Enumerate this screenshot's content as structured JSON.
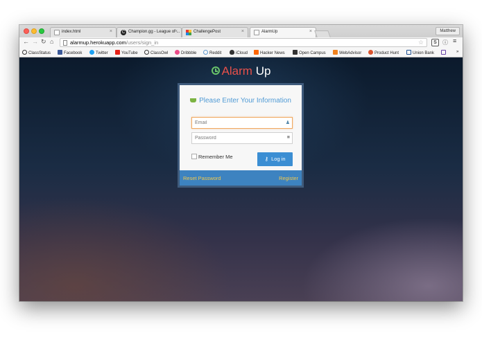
{
  "browser": {
    "tabs": [
      {
        "title": "index.html",
        "icon": "document-icon"
      },
      {
        "title": "Champion.gg - League of ...",
        "icon": "champion-gg-icon"
      },
      {
        "title": "ChallengePost",
        "icon": "challengepost-icon"
      },
      {
        "title": "AlarmUp",
        "icon": "document-icon"
      }
    ],
    "active_tab": 3,
    "profile_name": "Matthew",
    "url_host": "alarmup.herokuapp.com",
    "url_path": "/users/sign_in",
    "bookmarks": [
      {
        "label": "ClassStatus",
        "color": "#333333"
      },
      {
        "label": "Facebook",
        "color": "#3b5998"
      },
      {
        "label": "Twitter",
        "color": "#1da1f2"
      },
      {
        "label": "YouTube",
        "color": "#e62117"
      },
      {
        "label": "ClassOwl",
        "color": "#333333"
      },
      {
        "label": "Dribbble",
        "color": "#ea4c89"
      },
      {
        "label": "Reddit",
        "color": "#5f99cf"
      },
      {
        "label": "iCloud",
        "color": "#333333"
      },
      {
        "label": "Hacker News",
        "color": "#ff6600"
      },
      {
        "label": "Open Campus",
        "color": "#333333"
      },
      {
        "label": "WebAdvisor",
        "color": "#f0821e"
      },
      {
        "label": "Product Hunt",
        "color": "#da552f"
      },
      {
        "label": "Union Bank",
        "color": "#1a4d8f"
      }
    ],
    "overflow_glyph": "»"
  },
  "app": {
    "logo_part1": "Alarm",
    "logo_part2": "Up",
    "card_title": "Please Enter Your Information",
    "email_placeholder": "Email",
    "password_placeholder": "Password",
    "remember_label": "Remember Me",
    "login_label": "Log in",
    "reset_label": "Reset Password",
    "register_label": "Register"
  },
  "colors": {
    "accent": "#3b8ed3",
    "footer": "#3d83c0",
    "footer_link": "#f4c94a",
    "logo_red": "#e8504a",
    "logo_green": "#6ac46a"
  }
}
